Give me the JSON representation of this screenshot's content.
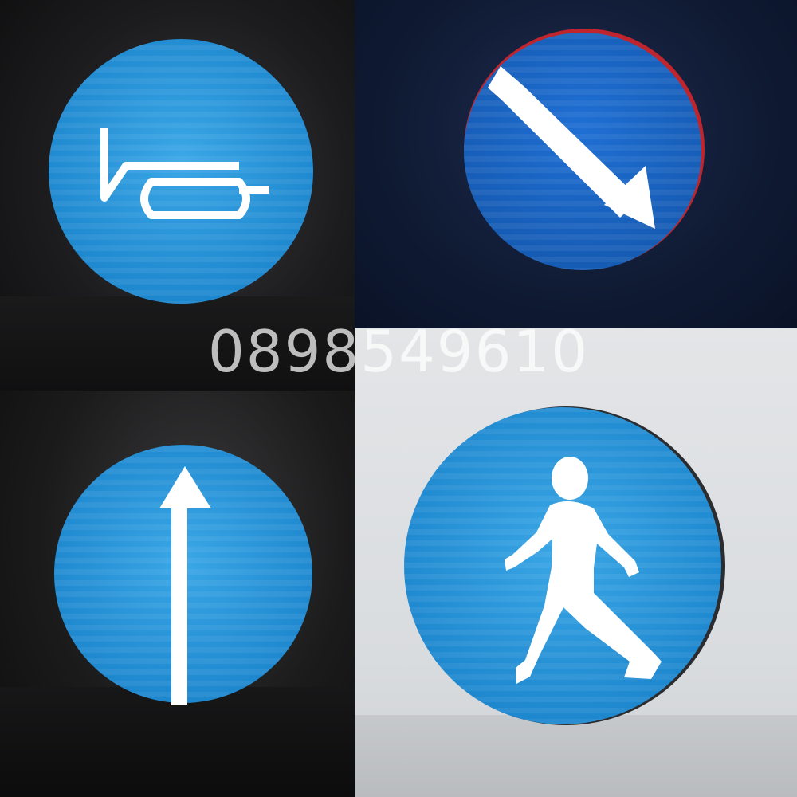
{
  "watermark": {
    "text": "0898549610"
  },
  "colors": {
    "sign_blue": "#1f8fd6",
    "sign_blue_dark": "#1565b8",
    "symbol_white": "#ffffff"
  },
  "signs": [
    {
      "id": "horn",
      "icon": "horn-icon"
    },
    {
      "id": "keep-right",
      "icon": "diagonal-arrow-icon"
    },
    {
      "id": "straight-ahead",
      "icon": "up-arrow-icon"
    },
    {
      "id": "pedestrian",
      "icon": "pedestrian-icon"
    }
  ]
}
